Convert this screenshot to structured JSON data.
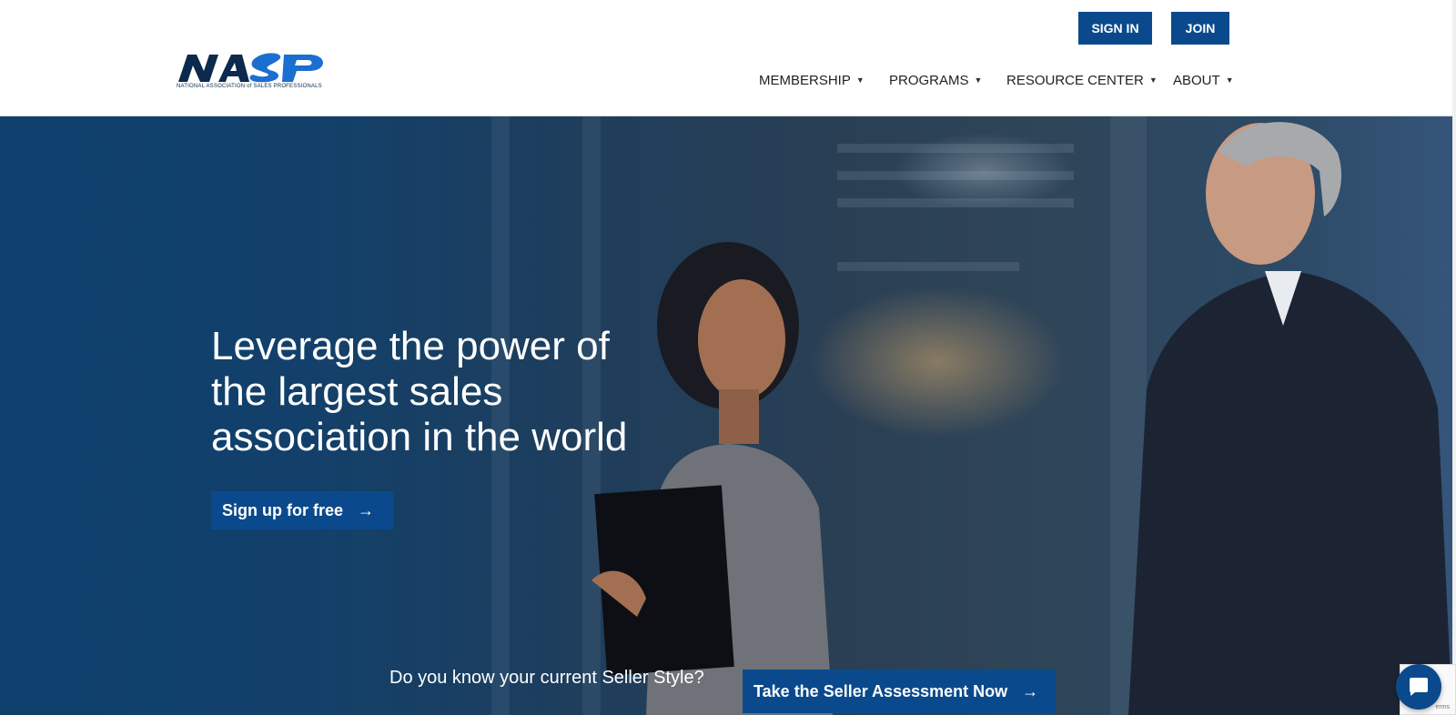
{
  "header": {
    "logo": {
      "wordmark": "NASP",
      "tagline": "NATIONAL ASSOCIATION of SALES PROFESSIONALS",
      "icon": "nasp-logo"
    },
    "auth": {
      "sign_in_label": "SIGN IN",
      "join_label": "JOIN"
    },
    "nav": {
      "items": [
        {
          "label": "MEMBERSHIP",
          "icon": "caret-down-icon"
        },
        {
          "label": "PROGRAMS",
          "icon": "caret-down-icon"
        },
        {
          "label": "RESOURCE CENTER",
          "icon": "caret-down-icon"
        },
        {
          "label": "ABOUT",
          "icon": "caret-down-icon"
        }
      ]
    }
  },
  "hero": {
    "title": "Leverage the power of the largest sales association in the world",
    "cta_label": "Sign up for free",
    "cta_icon": "arrow-right-icon",
    "seller_question": "Do you know your current Seller Style?",
    "assessment_label": "Take the Seller Assessment Now",
    "assessment_icon": "arrow-right-icon"
  },
  "widgets": {
    "recaptcha_text": "erms",
    "chat_icon": "chat-bubble-icon"
  },
  "colors": {
    "brand_blue": "#0a4a8c",
    "logo_navy": "#0c2a4d",
    "logo_blue": "#1b6fd0",
    "hero_overlay": "#0e3f6d"
  }
}
